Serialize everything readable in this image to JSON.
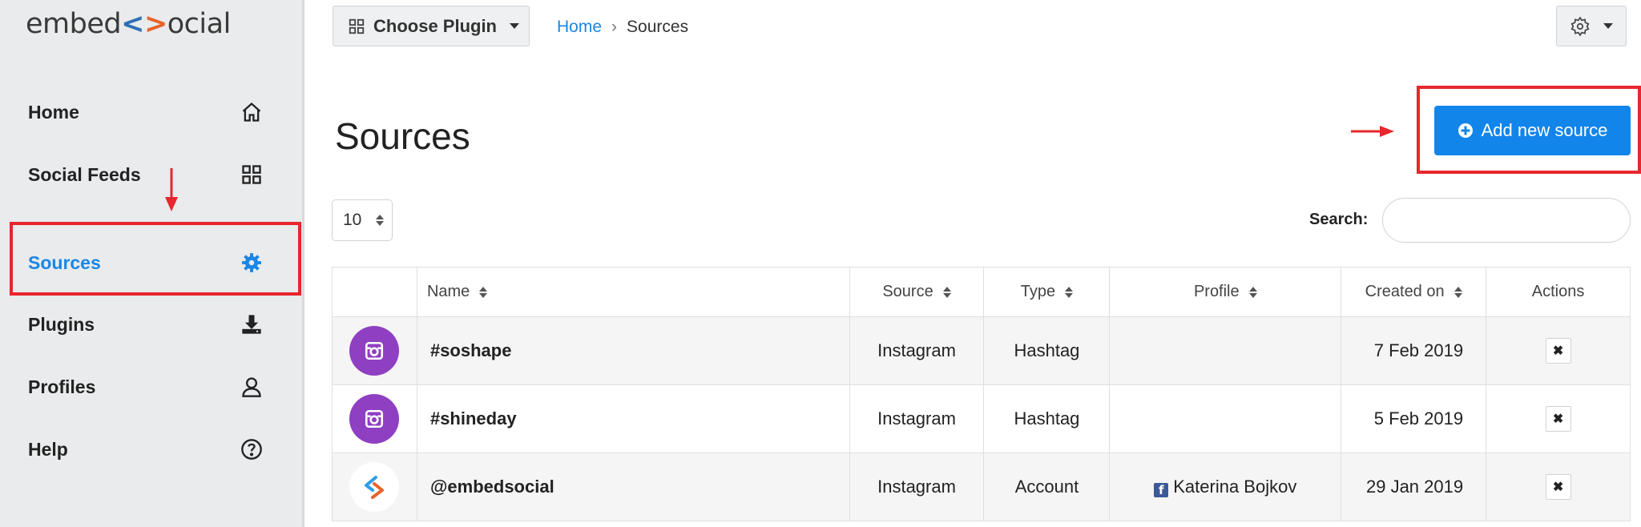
{
  "brand": {
    "logo_left": "embed",
    "logo_lt": "<",
    "logo_gt": ">",
    "logo_right": "ocial"
  },
  "sidebar": {
    "items": [
      {
        "label": "Home",
        "icon": "home-icon"
      },
      {
        "label": "Social Feeds",
        "icon": "grid-icon"
      },
      {
        "label": "Sources",
        "icon": "gear-icon",
        "active": true
      },
      {
        "label": "Plugins",
        "icon": "download-icon"
      },
      {
        "label": "Profiles",
        "icon": "user-icon"
      },
      {
        "label": "Help",
        "icon": "help-icon"
      }
    ]
  },
  "topbar": {
    "plugin_button": "Choose Plugin",
    "breadcrumb": {
      "home": "Home",
      "separator": "›",
      "current": "Sources"
    }
  },
  "page": {
    "title": "Sources",
    "add_button": "Add new source",
    "length_value": "10",
    "search_label": "Search:",
    "search_value": ""
  },
  "table": {
    "columns": [
      "Name",
      "Source",
      "Type",
      "Profile",
      "Created on",
      "Actions"
    ],
    "rows": [
      {
        "avatar": "instagram-icon",
        "name": "#soshape",
        "source": "Instagram",
        "type": "Hashtag",
        "profile": "",
        "created": "7 Feb 2019",
        "action": "✖"
      },
      {
        "avatar": "instagram-icon",
        "name": "#shineday",
        "source": "Instagram",
        "type": "Hashtag",
        "profile": "",
        "created": "5 Feb 2019",
        "action": "✖"
      },
      {
        "avatar": "embedsocial-icon",
        "name": "@embedsocial",
        "source": "Instagram",
        "type": "Account",
        "profile": "Katerina Bojkov",
        "created": "29 Jan 2019",
        "action": "✖"
      }
    ]
  },
  "colors": {
    "accent": "#1285ea",
    "highlight": "#e8262d",
    "instagram": "#8f3fc2"
  }
}
